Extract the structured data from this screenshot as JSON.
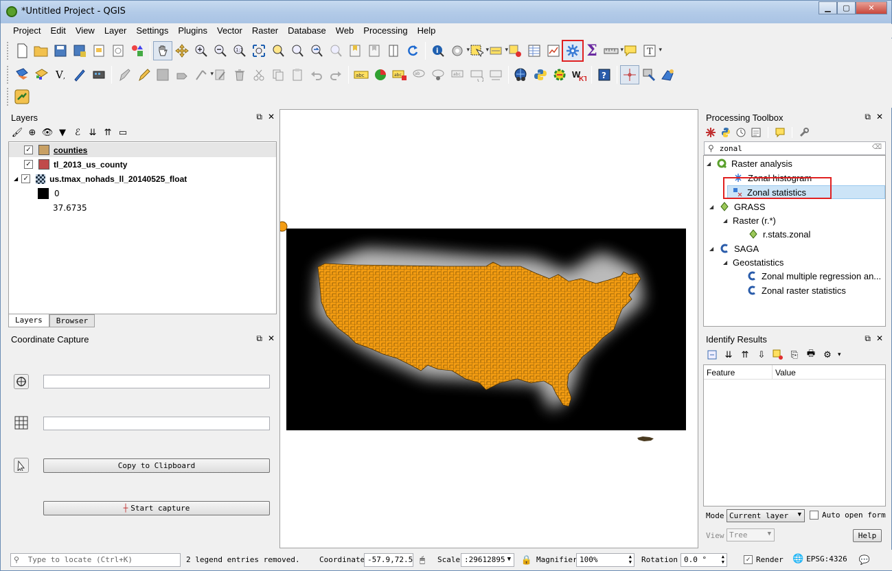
{
  "window": {
    "title": "*Untitled Project - QGIS"
  },
  "menu": [
    "Project",
    "Edit",
    "View",
    "Layer",
    "Settings",
    "Plugins",
    "Vector",
    "Raster",
    "Database",
    "Web",
    "Processing",
    "Help"
  ],
  "layers_panel": {
    "title": "Layers",
    "items": [
      {
        "name": "counties",
        "color": "#c8a064",
        "checked": true
      },
      {
        "name": "tl_2013_us_county",
        "color": "#c04a4a",
        "checked": true
      },
      {
        "name": "us.tmax_nohads_ll_20140525_float",
        "checked": true
      }
    ],
    "legend_min_label": "0",
    "legend_max_label": "37.6735",
    "tabs": [
      "Layers",
      "Browser"
    ]
  },
  "coordinate_capture": {
    "title": "Coordinate Capture",
    "copy_button": "Copy to Clipboard",
    "start_button": "Start capture"
  },
  "processing_toolbox": {
    "title": "Processing Toolbox",
    "search_value": "zonal",
    "tree": {
      "raster_analysis": "Raster analysis",
      "zonal_histogram": "Zonal histogram",
      "zonal_statistics": "Zonal statistics",
      "grass": "GRASS",
      "grass_raster": "Raster (r.*)",
      "r_stats_zonal": "r.stats.zonal",
      "saga": "SAGA",
      "geostatistics": "Geostatistics",
      "zonal_multiple_regression": "Zonal multiple regression an...",
      "zonal_raster_statistics": "Zonal raster statistics"
    }
  },
  "identify_results": {
    "title": "Identify Results",
    "columns": [
      "Feature",
      "Value"
    ],
    "mode_label": "Mode",
    "mode_value": "Current layer",
    "auto_open_label": "Auto open form",
    "view_label": "View",
    "view_value": "Tree",
    "help_button": "Help"
  },
  "status": {
    "locator_placeholder": "Type to locate (Ctrl+K)",
    "message": "2 legend entries removed.",
    "coordinate_label": "Coordinate",
    "coordinate_value": "-57.9,72.5",
    "scale_label": "Scale",
    "scale_value": ":29612895",
    "magnifier_label": "Magnifier",
    "magnifier_value": "100%",
    "rotation_label": "Rotation",
    "rotation_value": "0.0 °",
    "render_label": "Render",
    "crs": "EPSG:4326"
  },
  "colors": {
    "accent_highlight": "#e02020",
    "county_fill": "#f39c12",
    "raster_bg": "#000000",
    "selection": "#cce4f7"
  }
}
